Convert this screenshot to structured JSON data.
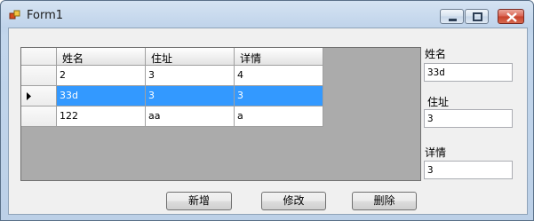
{
  "window": {
    "title": "Form1"
  },
  "grid": {
    "columns": [
      "姓名",
      "住址",
      "详情"
    ],
    "rows": [
      [
        "2",
        "3",
        "4"
      ],
      [
        "33d",
        "3",
        "3"
      ],
      [
        "122",
        "aa",
        "a"
      ]
    ],
    "selected_row": 1
  },
  "fields": {
    "name": {
      "label": "姓名",
      "value": "33d"
    },
    "address": {
      "label": "住址",
      "value": "3"
    },
    "detail": {
      "label": "详情",
      "value": "3"
    }
  },
  "buttons": {
    "add": "新增",
    "edit": "修改",
    "delete": "删除"
  },
  "colors": {
    "selection": "#3399ff"
  }
}
